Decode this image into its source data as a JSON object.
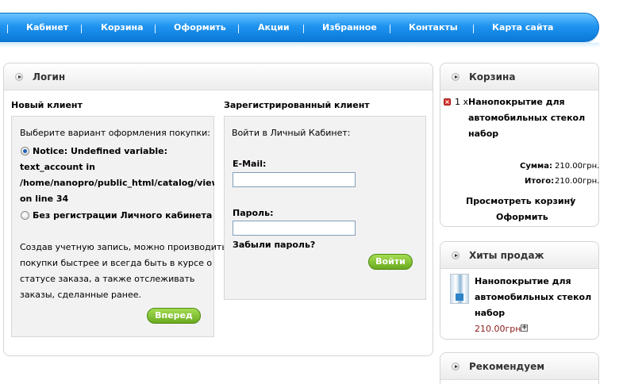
{
  "nav": {
    "items": [
      "Кабинет",
      "Корзина",
      "Оформить",
      "Акции",
      "Избранное",
      "Контакты",
      "Карта сайта"
    ]
  },
  "login": {
    "title": "Логин",
    "new_client": {
      "heading": "Новый клиент",
      "prompt": "Выберите вариант оформления покупки:",
      "notice_lines": [
        "Notice: Undefined variable:",
        "text_account in",
        "/home/nanopro/public_html/catalog/view/th",
        "on line 34"
      ],
      "option_guest": "Без регистрации Личного кабинета",
      "info_lines": [
        "Создав учетную запись, можно производить",
        "покупки быстрее и всегда быть в курсе о",
        "статусе заказа, а также отслеживать",
        "заказы, сделанные ранее."
      ],
      "continue_button": "Вперед"
    },
    "registered": {
      "heading": "Зарегистрированный клиент",
      "prompt": "Войти в Личный Кабинет:",
      "email_label": "E-Mail:",
      "email_value": "",
      "password_label": "Пароль:",
      "password_value": "",
      "forgot_link": "Забыли пароль?",
      "login_button": "Войти"
    }
  },
  "cart": {
    "title": "Корзина",
    "item_qty": "1 x",
    "item_name_lines": [
      "Нанопокрытие для",
      "автомобильных стекол",
      "набор"
    ],
    "sum_label": "Сумма:",
    "sum_value": "210.00грн.",
    "total_label": "Итого:",
    "total_value": "210.00грн.",
    "view_cart": "Просмотреть корзину",
    "separator": "|",
    "checkout": "Оформить"
  },
  "bestsellers": {
    "title": "Хиты продаж",
    "item_name_lines": [
      "Нанопокрытие для",
      "автомобильных стекол",
      "набор"
    ],
    "price": "210.00грн."
  },
  "recommended": {
    "title": "Рекомендуем"
  },
  "colors": {
    "nav_blue": "#1f94f0",
    "button_green": "#6aaa1f",
    "price_red": "#8b1a1a"
  }
}
